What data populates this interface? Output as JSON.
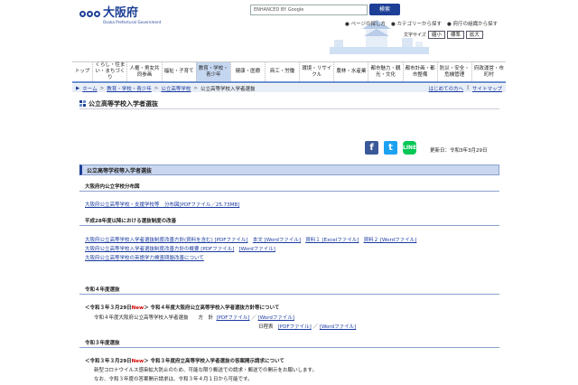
{
  "header": {
    "logo_jp": "大阪府",
    "logo_en": "Osaka Prefectural Government",
    "search_placeholder": "ENHANCED BY Google",
    "search_button": "検索",
    "toplinks": [
      "ページの探し方",
      "カテゴリーから探す",
      "府庁の組織から探す"
    ],
    "text_size_label": "文字サイズ",
    "text_sizes": [
      "縮小",
      "標準",
      "拡大"
    ]
  },
  "nav": [
    {
      "label": "トップ",
      "active": false
    },
    {
      "label": "くらし・住まい・まちづくり",
      "active": false
    },
    {
      "label": "人権・男女共同参画",
      "active": false
    },
    {
      "label": "福祉・子育て",
      "active": false
    },
    {
      "label": "教育・学校・青少年",
      "active": true
    },
    {
      "label": "健康・医療",
      "active": false
    },
    {
      "label": "商工・労働",
      "active": false
    },
    {
      "label": "環境・リサイクル",
      "active": false
    },
    {
      "label": "農林・水産業",
      "active": false
    },
    {
      "label": "都市魅力・観光・文化",
      "active": false
    },
    {
      "label": "都市計画・都市整備",
      "active": false
    },
    {
      "label": "防災・安全・危機管理",
      "active": false
    },
    {
      "label": "府政運営・市町村",
      "active": false
    }
  ],
  "breadcrumb": {
    "items": [
      "ホーム",
      "教育・学校・青少年",
      "公立高等学校",
      "公立高等学校入学者選抜"
    ],
    "right": [
      "はじめての方へ",
      "サイトマップ"
    ]
  },
  "page_title": "公立高等学校入学者選抜",
  "social": {
    "updated": "更新日：令和3年3月29日"
  },
  "sections": {
    "main": "公立高等学校等入学者選抜",
    "distribution": {
      "heading": "大阪府内公立学校分布図",
      "link": "大阪府公立高等学校・支援学校等　分布図[PDFファイル／25.73MB]"
    },
    "reform": {
      "heading": "平成28年度以降における選抜制度の改善",
      "line1": [
        "大阪府公立高等学校入学者選抜制度改善方針(資料を含む) [PDFファイル]",
        "本文 [Wordファイル]",
        "資料１ [Excelファイル]",
        "資料２ [Wordファイル]"
      ],
      "line2": [
        "大阪府公立高等学校入学者選抜制度改善方針の概要 [PDFファイル]",
        "[Wordファイル]"
      ],
      "line3": "大阪府公立高等学校の英語学力検査問題改善について"
    },
    "r4": {
      "heading": "令和４年度選抜",
      "notice_date": "＜令和３年３月29日",
      "new": "New",
      "notice_text": "＞ 令和４年度大阪府公立高等学校入学者選抜方針等について",
      "policy_label": "令和４年度大阪府公立高等学校入学者選抜　　方　針",
      "policy_pdf": "[PDFファイル]",
      "policy_word": "[Wordファイル]",
      "schedule_label": "日程表",
      "schedule_pdf": "[PDFファイル]",
      "schedule_word": "[Wordファイル]",
      "slash": "／"
    },
    "r3": {
      "heading": "令和３年度選抜",
      "notice_date": "＜令和３年３月29日",
      "new": "New",
      "notice_text": "＞ 令和３年度府立高等学校入学者選抜の答案開示請求について",
      "line1": "新型コロナウイルス感染拡大防止のため、可能な限り郵送での請求・郵送での開示をお願いします。",
      "line2": "なお、令和３年度の答案開示請求は、令和３年４月１日から可能です。"
    }
  }
}
